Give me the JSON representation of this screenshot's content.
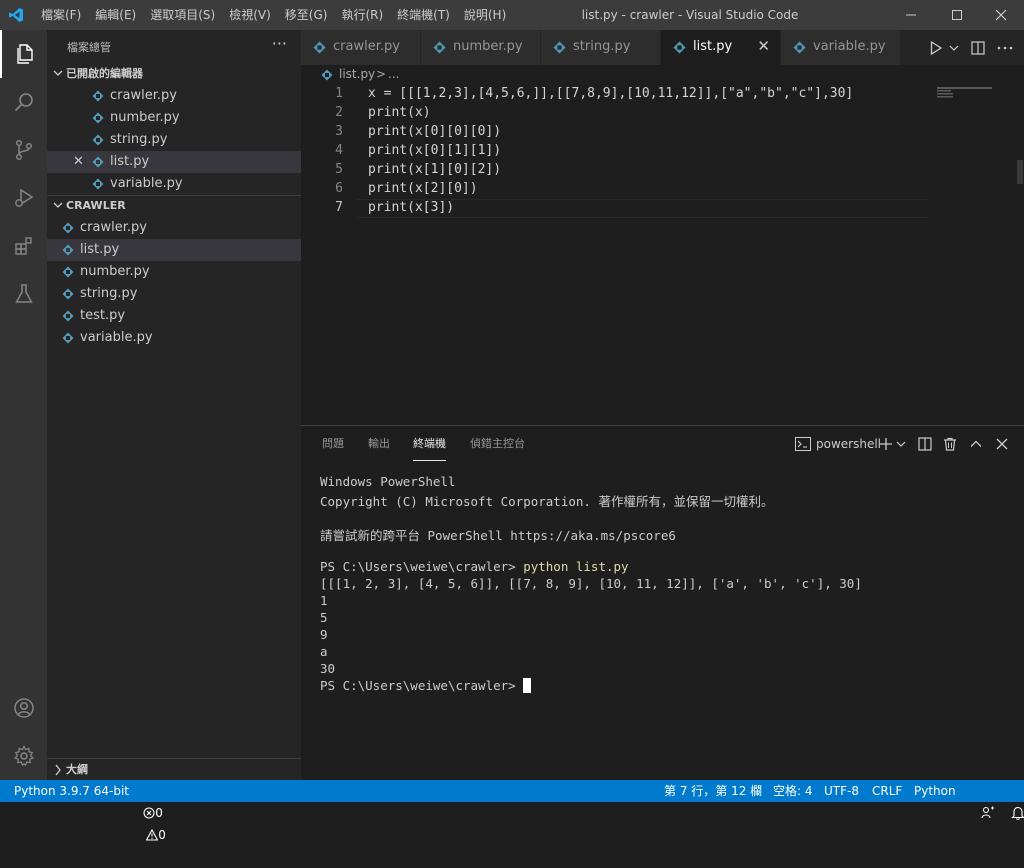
{
  "titlebar": {
    "menu": [
      "檔案(F)",
      "編輯(E)",
      "選取項目(S)",
      "檢視(V)",
      "移至(G)",
      "執行(R)",
      "終端機(T)",
      "說明(H)"
    ],
    "window_title": "list.py - crawler - Visual Studio Code",
    "minimize_glyph": "—",
    "maximize_glyph": "☐",
    "close_glyph": "✕"
  },
  "sidebar": {
    "title": "檔案總管",
    "more_glyph": "···",
    "open_editors": {
      "label": "已開啟的編輯器",
      "files": [
        {
          "name": "crawler.py"
        },
        {
          "name": "number.py"
        },
        {
          "name": "string.py"
        },
        {
          "name": "list.py",
          "selected": true,
          "close_glyph": "✕"
        },
        {
          "name": "variable.py"
        }
      ]
    },
    "workspace": {
      "label": "CRAWLER",
      "files": [
        {
          "name": "crawler.py"
        },
        {
          "name": "list.py",
          "selected": true
        },
        {
          "name": "number.py"
        },
        {
          "name": "string.py"
        },
        {
          "name": "test.py"
        },
        {
          "name": "variable.py"
        }
      ]
    },
    "outline_label": "大綱"
  },
  "tabs": [
    {
      "name": "crawler.py"
    },
    {
      "name": "number.py"
    },
    {
      "name": "string.py"
    },
    {
      "name": "list.py",
      "active": true,
      "close_glyph": "✕"
    },
    {
      "name": "variable.py"
    }
  ],
  "breadcrumb": {
    "file": "list.py",
    "sep": ">",
    "rest": "..."
  },
  "editor": {
    "line_numbers": [
      "1",
      "2",
      "3",
      "4",
      "5",
      "6",
      "7"
    ],
    "lines": [
      "x = [[[1,2,3],[4,5,6,]],[[7,8,9],[10,11,12]],[\"a\",\"b\",\"c\"],30]",
      "print(x)",
      "print(x[0][0][0])",
      "print(x[0][1][1])",
      "print(x[1][0][2])",
      "print(x[2][0])",
      "print(x[3])"
    ],
    "current_line": 7
  },
  "panel": {
    "tabs": [
      "問題",
      "輸出",
      "終端機",
      "偵錯主控台"
    ],
    "active_tab": "終端機",
    "shell_name": "powershell",
    "terminal": {
      "lines": [
        "Windows PowerShell",
        "Copyright (C) Microsoft Corporation. 著作權所有，並保留一切權利。",
        "",
        "請嘗試新的跨平台 PowerShell https://aka.ms/pscore6",
        "",
        "PS C:\\Users\\weiwe\\crawler> ",
        "[[[1, 2, 3], [4, 5, 6]], [[7, 8, 9], [10, 11, 12]], ['a', 'b', 'c'], 30]",
        "1",
        "5",
        "9",
        "a",
        "30",
        "PS C:\\Users\\weiwe\\crawler> "
      ],
      "command": "python list.py"
    }
  },
  "statusbar": {
    "python": "Python 3.9.7 64-bit",
    "errors": "0",
    "warnings": "0",
    "position": "第 7 行，第 12 欄",
    "spaces": "空格: 4",
    "encoding": "UTF-8",
    "eol": "CRLF",
    "language": "Python"
  },
  "colors": {
    "accent": "#007acc",
    "python_icon": "#519aba",
    "titlebar": "#3c3c3c",
    "sidebar": "#252526",
    "editor": "#1e1e1e",
    "keyword_yellow": "#dcdcaa"
  }
}
